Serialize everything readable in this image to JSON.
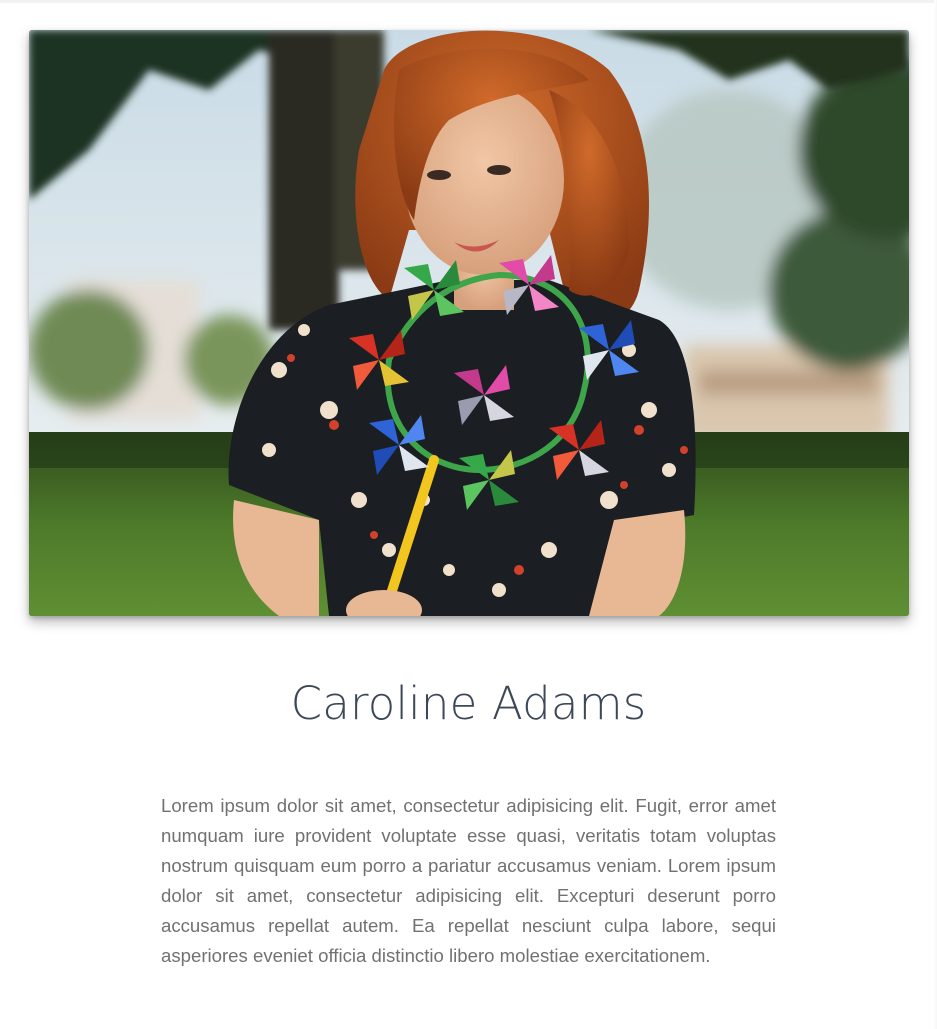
{
  "profile": {
    "photo_alt": "Woman with red hair in floral dress holding colorful pinwheels in a park",
    "name": "Caroline Adams",
    "bio": "Lorem ipsum dolor sit amet, consectetur adipisicing elit. Fugit, error amet numquam iure provident voluptate esse quasi, veritatis totam voluptas nostrum quisquam eum porro a pariatur accusamus veniam. Lorem ipsum dolor sit amet, consectetur adipisicing elit. Excepturi deserunt porro accusamus repellat autem. Ea repellat nesciunt culpa labore, sequi asperiores eveniet officia distinctio libero molestiae exercitationem."
  },
  "colors": {
    "name_text": "#3c4858",
    "body_text": "#717171",
    "background": "#ffffff"
  }
}
